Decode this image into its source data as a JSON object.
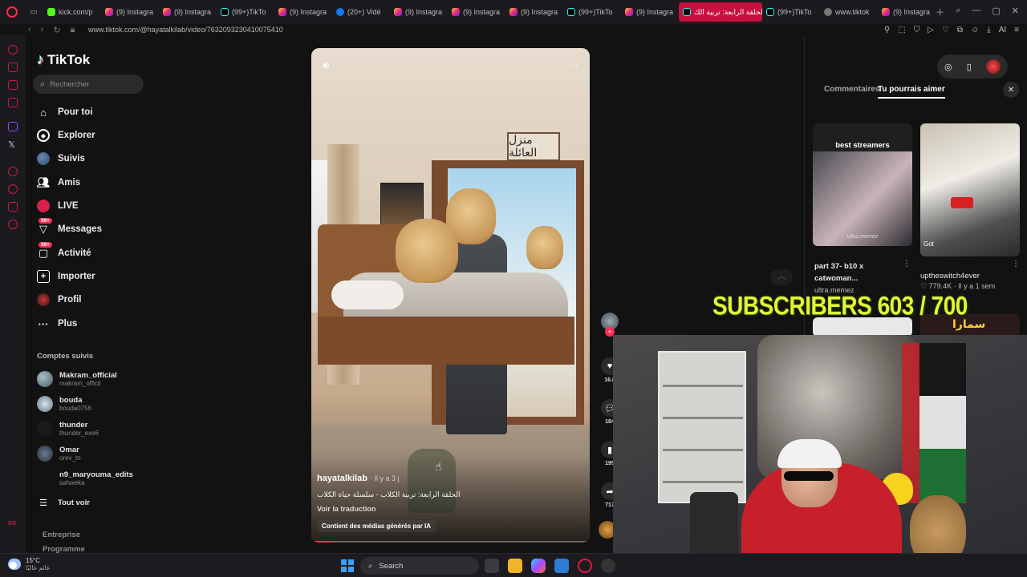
{
  "browser": {
    "tabs": [
      {
        "label": "kick.com/p",
        "icon": "kick-icon"
      },
      {
        "label": "(9) Instagra",
        "icon": "instagram-icon"
      },
      {
        "label": "(9) Instagra",
        "icon": "instagram-icon"
      },
      {
        "label": "(99+)TikTo",
        "icon": "tiktok-icon"
      },
      {
        "label": "(9) Instagra",
        "icon": "instagram-icon"
      },
      {
        "label": "(20+) Vidé",
        "icon": "facebook-icon"
      },
      {
        "label": "(9) Instagra",
        "icon": "instagram-icon"
      },
      {
        "label": "(9) Instagra",
        "icon": "instagram-icon"
      },
      {
        "label": "(9) Instagra",
        "icon": "instagram-icon"
      },
      {
        "label": "(99+)TikTo",
        "icon": "tiktok-icon"
      },
      {
        "label": "(9) Instagra",
        "icon": "instagram-icon"
      },
      {
        "label": "الحلقة الرابعة: تربية الك",
        "icon": "tiktok-icon",
        "active": true
      },
      {
        "label": "(99+)TikTo",
        "icon": "tiktok-icon"
      },
      {
        "label": "www.tiktok",
        "icon": "globe-icon"
      },
      {
        "label": "(9) Instagra",
        "icon": "instagram-icon"
      }
    ],
    "url": "www.tiktok.com/@hayatalkilab/video/7632093230410075410",
    "ai_label": "AI",
    "accent": "#c8103e"
  },
  "sidebar": {
    "logo": "TikTok",
    "search_placeholder": "Rechercher",
    "nav": [
      {
        "label": "Pour toi",
        "icon": "home-icon"
      },
      {
        "label": "Explorer",
        "icon": "compass-icon"
      },
      {
        "label": "Suivis",
        "icon": "following-avatar-icon"
      },
      {
        "label": "Amis",
        "icon": "friends-icon"
      },
      {
        "label": "LIVE",
        "icon": "live-icon"
      },
      {
        "label": "Messages",
        "icon": "messages-icon",
        "badge": "99+"
      },
      {
        "label": "Activité",
        "icon": "activity-icon",
        "badge": "99+"
      },
      {
        "label": "Importer",
        "icon": "upload-icon"
      },
      {
        "label": "Profil",
        "icon": "profile-avatar-icon"
      },
      {
        "label": "Plus",
        "icon": "more-icon"
      }
    ],
    "followed_title": "Comptes suivis",
    "followed": [
      {
        "name": "Makram_official",
        "handle": "makram_officil"
      },
      {
        "name": "bouda",
        "handle": "bouda0756"
      },
      {
        "name": "thunder",
        "handle": "thunder_exe6"
      },
      {
        "name": "Omar",
        "handle": "orev_tn"
      },
      {
        "name": "n9_maryouma_edits",
        "handle": "sahweka"
      }
    ],
    "see_all": "Tout voir",
    "footer": [
      "Entreprise",
      "Programme"
    ]
  },
  "video": {
    "sign_text": "منزل العائلة",
    "username": "hayatalkilab",
    "time": "· Il y a 3 j",
    "description": "الحلقة الرابعة: تربية الكلاب - سلسلة حياة الكلاب",
    "translate": "Voir la traduction",
    "ai_label": "Contient des médias générés par IA",
    "progress": 0.08
  },
  "actions": [
    {
      "name": "like",
      "icon": "heart-icon",
      "count": "16.8"
    },
    {
      "name": "comment",
      "icon": "comment-icon",
      "count": "184"
    },
    {
      "name": "save",
      "icon": "bookmark-icon",
      "count": "195"
    },
    {
      "name": "share",
      "icon": "share-icon",
      "count": "717"
    }
  ],
  "right_panel": {
    "tabs": [
      "Commentaires",
      "Tu pourrais aimer"
    ],
    "active_tab": "Tu pourrais aimer",
    "cards": [
      {
        "overlay": "best streamers",
        "watermark": "ultra.memez",
        "title": "part 37- b10 x catwoman...",
        "author": "ultra.memez"
      },
      {
        "overlay": "Got",
        "title": "uptheswitch4ever",
        "stats": "♡ 779.4K · Il y a 1 sem"
      }
    ],
    "card3_text": "سمارا"
  },
  "overlay": {
    "subscribers": "SUBSCRIBERS 603 / 700",
    "subscribers_color": "#e1f53a"
  },
  "taskbar": {
    "temp": "15°C",
    "weather_desc": "غائم غالبًا",
    "search": "Search"
  }
}
